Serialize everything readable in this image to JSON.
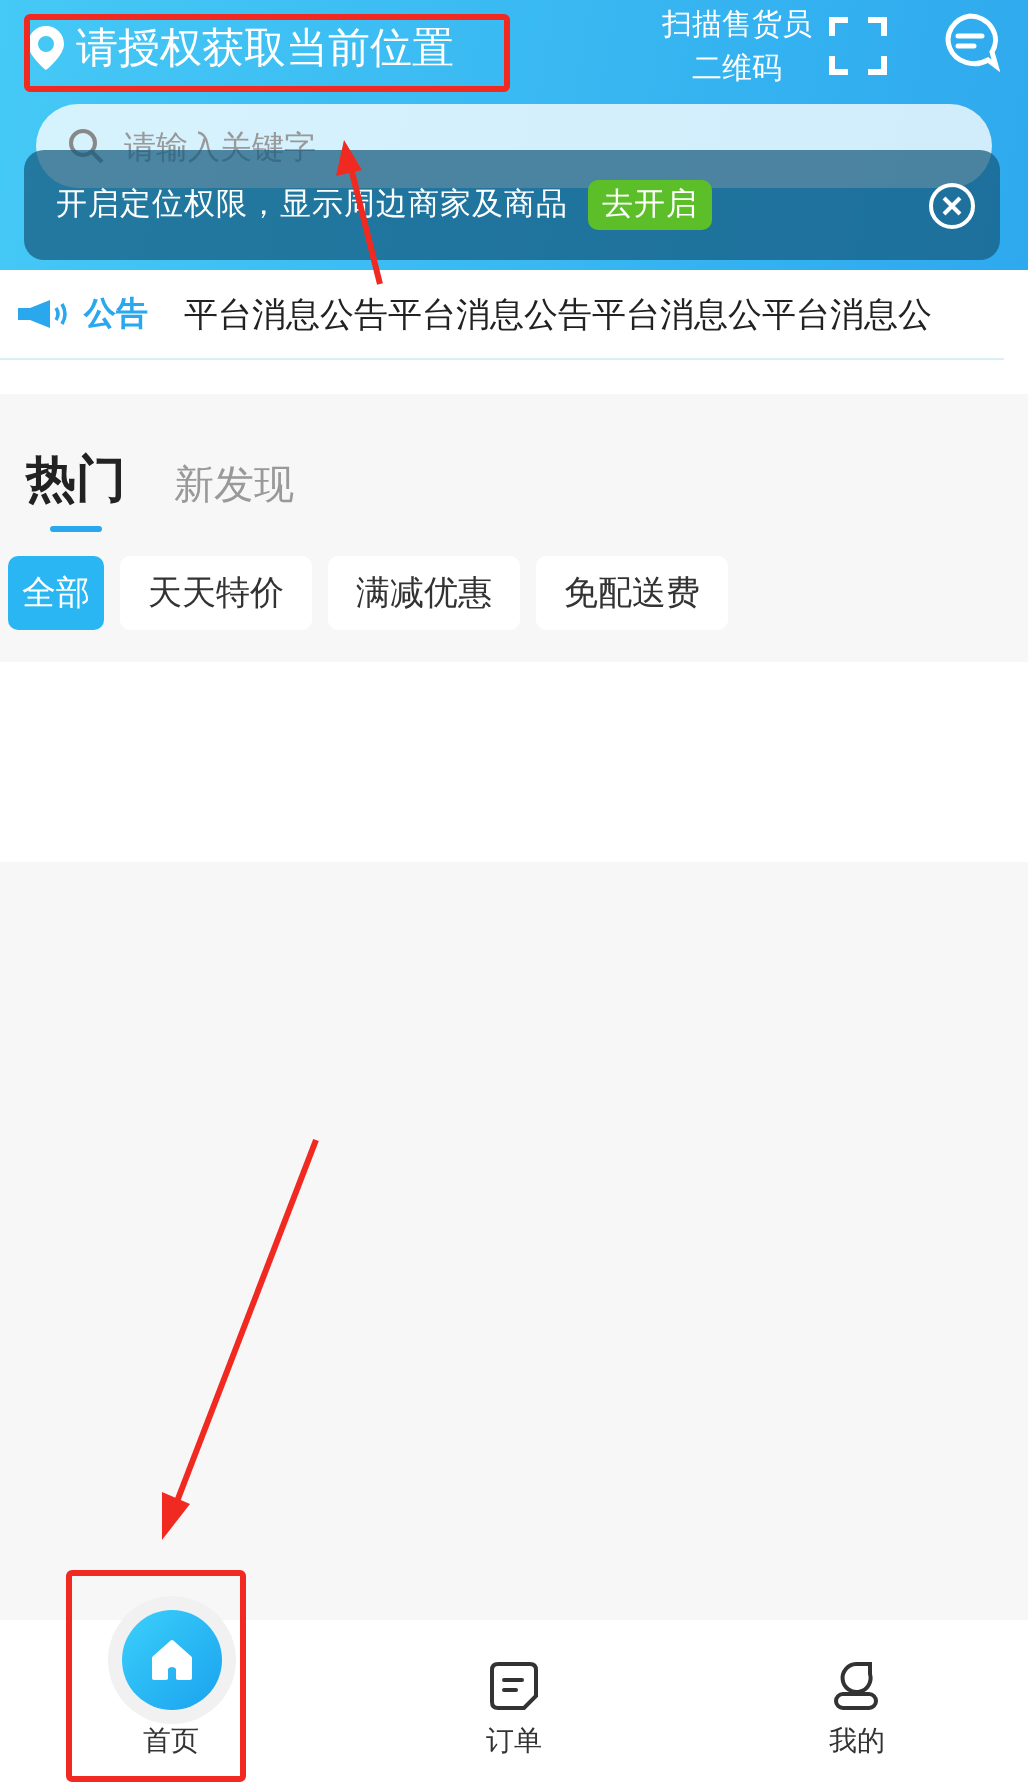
{
  "location": {
    "text": "请授权获取当前位置"
  },
  "scan": {
    "lines": [
      "扫描售货员",
      "二维码"
    ]
  },
  "search": {
    "placeholder": "请输入关键字"
  },
  "location_banner": {
    "message": "开启定位权限，显示周边商家及商品",
    "action": "去开启"
  },
  "notice": {
    "label": "公告",
    "text": "平台消息公告平台消息公告平台消息公平台消息公"
  },
  "feed_tabs": [
    {
      "label": "热门",
      "selected": true
    },
    {
      "label": "新发现",
      "selected": false
    }
  ],
  "filters": [
    {
      "label": "全部",
      "selected": true
    },
    {
      "label": "天天特价",
      "selected": false
    },
    {
      "label": "满减优惠",
      "selected": false
    },
    {
      "label": "免配送费",
      "selected": false
    }
  ],
  "bottom_nav": [
    {
      "label": "首页",
      "kind": "home",
      "selected": true
    },
    {
      "label": "订单",
      "kind": "order",
      "selected": false
    },
    {
      "label": "我的",
      "kind": "profile",
      "selected": false
    }
  ]
}
